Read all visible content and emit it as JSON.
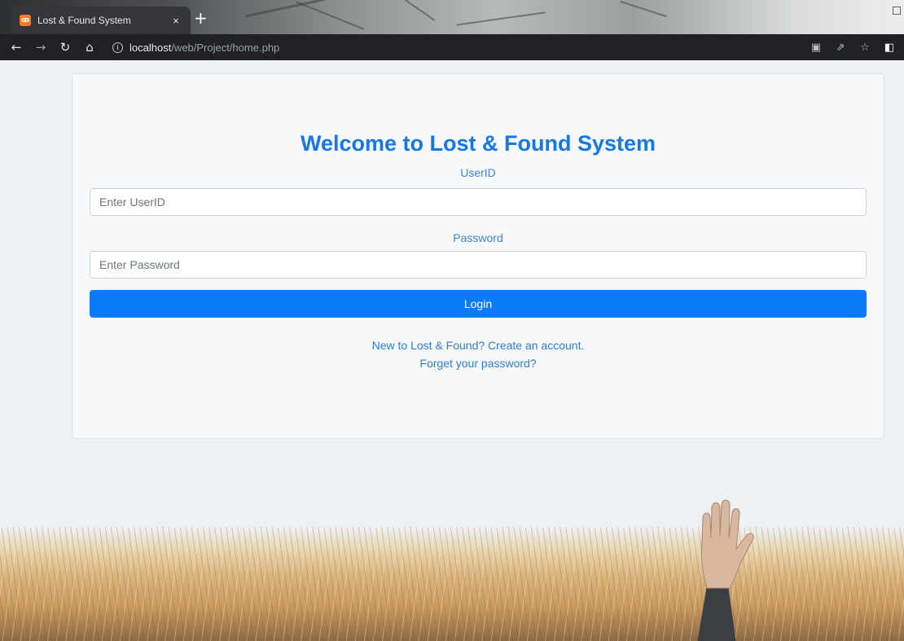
{
  "browser": {
    "tab_title": "Lost & Found System",
    "tab_favicon": "XAMPP",
    "tab_close": "×",
    "new_tab": "+",
    "url_host": "localhost",
    "url_path": "/web/Project/home.php",
    "icons": [
      "back-arrow-icon",
      "forward-arrow-icon",
      "reload-icon",
      "home-icon",
      "info-icon",
      "translate-icon",
      "share-icon",
      "star-icon",
      "side-panel-icon"
    ]
  },
  "login": {
    "title": "Welcome to Lost & Found System",
    "userid_label": "UserID",
    "userid_placeholder": "Enter UserID",
    "password_label": "Password",
    "password_placeholder": "Enter Password",
    "login_button": "Login",
    "create_account_link": "New to Lost & Found? Create an account.",
    "forgot_password_link": "Forget your password?"
  },
  "colors": {
    "accent": "#0a7cf8",
    "title": "#1677e5",
    "link": "#2f7ed2"
  }
}
